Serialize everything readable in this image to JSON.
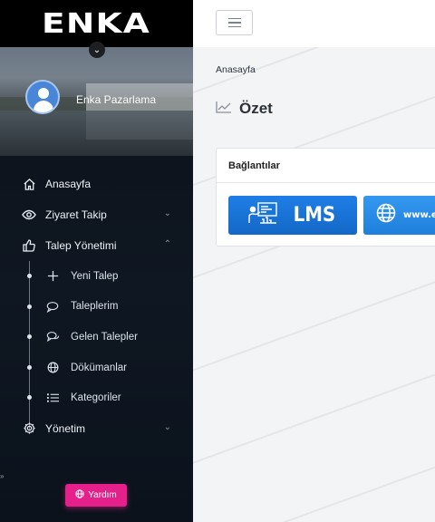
{
  "brand": {
    "logo_text": "ENKA"
  },
  "profile": {
    "user_name": "Enka Pazarlama"
  },
  "menu": {
    "items": [
      {
        "label": "Anasayfa",
        "icon": "home-icon"
      },
      {
        "label": "Ziyaret Takip",
        "icon": "eye-icon"
      },
      {
        "label": "Talep Yönetimi",
        "icon": "thumbs-up-icon",
        "expanded": true
      },
      {
        "label": "Yönetim",
        "icon": "gear-icon"
      }
    ],
    "sub_items": [
      {
        "label": "Yeni Talep",
        "icon": "plus-icon"
      },
      {
        "label": "Taleplerim",
        "icon": "chat-bubble-icon"
      },
      {
        "label": "Gelen Talepler",
        "icon": "chat-bubbles-icon"
      },
      {
        "label": "Dökümanlar",
        "icon": "globe-icon"
      },
      {
        "label": "Kategoriler",
        "icon": "list-icon"
      }
    ]
  },
  "help": {
    "label": "Yardım"
  },
  "edge": {
    "glyph": "»"
  },
  "breadcrumb": "Anasayfa",
  "page": {
    "title": "Özet"
  },
  "card": {
    "title": "Bağlantılar",
    "tiles": [
      {
        "label": "LMS",
        "icon": "presentation-icon"
      },
      {
        "label": "www.er",
        "icon": "globe-icon"
      }
    ]
  },
  "colors": {
    "sidebar_bg": "#0c1016",
    "help_button": "#e6208a",
    "tile_blue": "#1e7ee6",
    "tile_light_blue": "#3498f0"
  }
}
